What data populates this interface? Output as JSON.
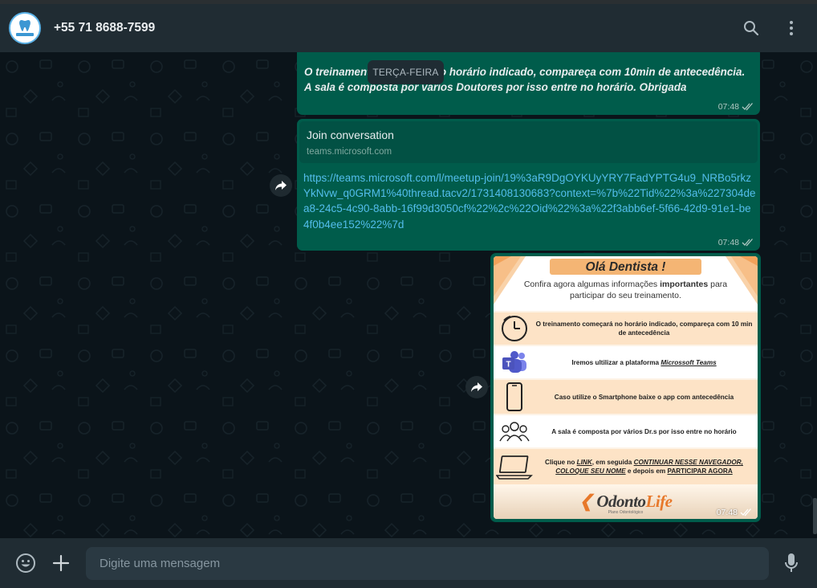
{
  "header": {
    "contact_name": "+55 71 8688-7599",
    "avatar_text": "orthoclin",
    "icons": [
      "search-icon",
      "menu-dots-icon"
    ]
  },
  "chat": {
    "date_separator": "TERÇA-FEIRA",
    "messages": [
      {
        "text": "O treinamento começará no horário indicado, compareça com 10min de antecedência. A sala é composta por vários Doutores por isso entre no horário. Obrigada",
        "time": "07:48",
        "status": "read"
      },
      {
        "preview_title": "Join conversation",
        "preview_domain": "teams.microsoft.com",
        "link": "https://teams.microsoft.com/l/meetup-join/19%3aR9DgOYKUyYRY7FadYPTG4u9_NRBo5rkzYkNvw_q0GRM1%40thread.tacv2/1731408130683?context=%7b%22Tid%22%3a%227304dea8-24c5-4c90-8abb-16f99d3050cf%22%2c%22Oid%22%3a%22f3abb6ef-5f66-42d9-91e1-be4f0b4ee152%22%7d",
        "time": "07:48",
        "status": "read"
      },
      {
        "type": "image",
        "flyer": {
          "title": "Olá Dentista !",
          "subtitle_pre": "Confira agora algumas informações ",
          "subtitle_bold": "importantes",
          "subtitle_post": " para participar do seu treinamento.",
          "row1": "O treinamento começará no horário indicado, compareça com 10 min de antecedência",
          "row2_pre": "Iremos ultilizar a plataforma ",
          "row2_em": "Microssoft Teams",
          "row3": "Caso utilize o Smartphone baixe o app com antecedência",
          "row4": "A sala é composta por vários Dr.s por isso entre no horário",
          "row5_a": "Clique no ",
          "row5_b": "LINK",
          "row5_c": ", em seguida ",
          "row5_d": "CONTINUAR NESSE NAVEGADOR, COLOQUE SEU NOME",
          "row5_e": " e depois em ",
          "row5_f": "PARTICIPAR AGORA",
          "logo_a": "Odonto",
          "logo_b": "Life",
          "logo_sub": "Plano Odontológico"
        },
        "time": "07:48",
        "status": "read"
      }
    ]
  },
  "composer": {
    "placeholder": "Digite uma mensagem",
    "value": ""
  },
  "colors": {
    "header_bg": "#202c33",
    "chat_bg": "#0b141a",
    "outgoing_bubble": "#005c4b",
    "link": "#53bdeb",
    "flyer_accent": "#e7782a"
  }
}
